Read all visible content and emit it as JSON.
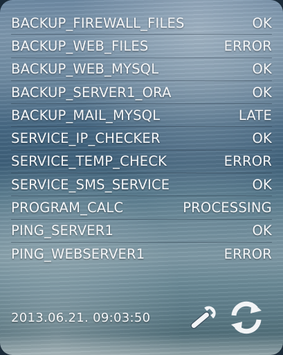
{
  "jobs": [
    {
      "name": "BACKUP_FIREWALL_FILES",
      "status": "OK"
    },
    {
      "name": "BACKUP_WEB_FILES",
      "status": "ERROR"
    },
    {
      "name": "BACKUP_WEB_MYSQL",
      "status": "OK"
    },
    {
      "name": "BACKUP_SERVER1_ORA",
      "status": "OK"
    },
    {
      "name": "BACKUP_MAIL_MYSQL",
      "status": "LATE"
    },
    {
      "name": "SERVICE_IP_CHECKER",
      "status": "OK"
    },
    {
      "name": "SERVICE_TEMP_CHECK",
      "status": "ERROR"
    },
    {
      "name": "SERVICE_SMS_SERVICE",
      "status": "OK"
    },
    {
      "name": "PROGRAM_CALC",
      "status": "PROCESSING"
    },
    {
      "name": "PING_SERVER1",
      "status": "OK"
    },
    {
      "name": "PING_WEBSERVER1",
      "status": "ERROR"
    }
  ],
  "footer": {
    "timestamp": "2013.06.21. 09:03:50",
    "settings_icon": "wrench-icon",
    "refresh_icon": "refresh-icon"
  },
  "colors": {
    "text": "#f4f6f8",
    "icon": "#f2f4f6"
  }
}
